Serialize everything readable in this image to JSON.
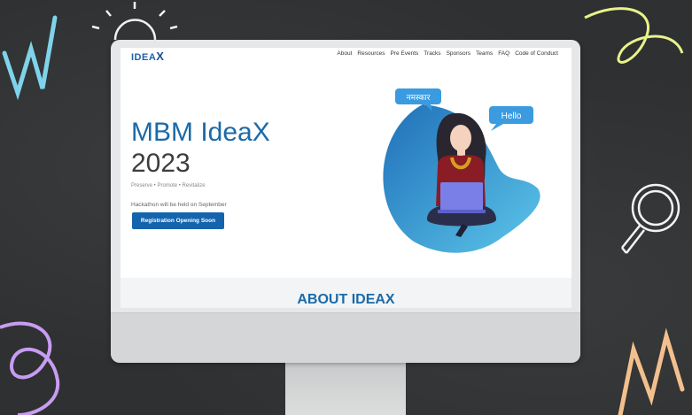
{
  "site": {
    "logo_main": "IDEA",
    "logo_x": "X",
    "nav": [
      "About",
      "Resources",
      "Pre Events",
      "Tracks",
      "Sponsors",
      "Teams",
      "FAQ",
      "Code of Conduct"
    ]
  },
  "hero": {
    "title": "MBM IdeaX",
    "year": "2023",
    "tagline": "Preserve • Promote • Revitalize",
    "note": "Hackathon will be held on September",
    "button": "Registration Opening Soon"
  },
  "illustration": {
    "bubble_left": "नमस्कार",
    "bubble_right": "Hello"
  },
  "about": {
    "title": "ABOUT IDEAX"
  },
  "colors": {
    "primary": "#1464ad",
    "heading": "#1b6aa8",
    "bubble": "#2f8fd6",
    "background": "#2e3031"
  }
}
